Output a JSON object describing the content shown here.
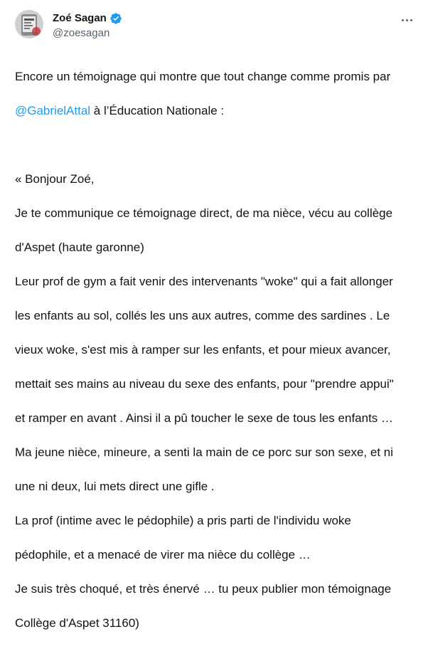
{
  "author": {
    "display_name": "Zoé Sagan",
    "handle": "@zoesagan",
    "verified": true,
    "verified_color": "#1d9bf0"
  },
  "menu": {
    "icon": "more-horizontal-icon"
  },
  "body": {
    "intro_line1": "Encore un témoignage qui montre que tout change comme promis par",
    "mention": "@GabrielAttal",
    "intro_line2_rest": " à l’Éducation Nationale :",
    "quote_lines": [
      "« Bonjour Zoé,",
      "Je te communique ce témoignage direct, de ma nièce, vécu au collège",
      "d'Aspet (haute garonne)",
      "Leur prof de gym a fait venir des intervenants \"woke\" qui a fait allonger",
      "les enfants au sol, collés les uns aux autres, comme des sardines . Le",
      "vieux woke, s'est mis à ramper sur les enfants, et pour mieux avancer,",
      "mettait ses mains au niveau du sexe des enfants, pour \"prendre appui\"",
      "et ramper en avant . Ainsi il a pû toucher le sexe de tous les enfants …",
      "Ma jeune nièce, mineure, a senti la main de ce porc sur son sexe, et ni",
      "une ni deux, lui mets direct une gifle .",
      "La prof (intime avec le pédophile) a pris parti de l'individu woke",
      "pédophile, et a menacé de virer ma nièce du collège …",
      "Je suis très choqué, et très énervé … tu peux publier mon témoignage",
      "Collège d'Aspet 31160)"
    ]
  },
  "colors": {
    "text": "#0f1419",
    "secondary": "#536471",
    "link": "#1d9bf0"
  }
}
